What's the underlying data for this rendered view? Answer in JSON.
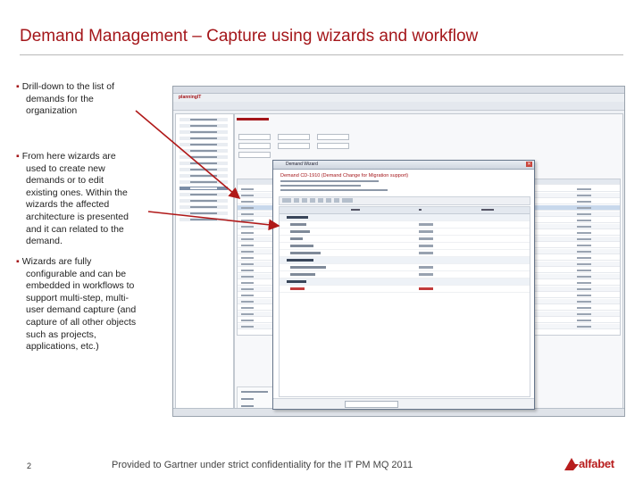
{
  "slide": {
    "title": "Demand Management – Capture using wizards and workflow",
    "page_number": "2",
    "footer": "Provided to Gartner under strict confidentiality for the IT PM MQ 2011",
    "brand": "alfabet",
    "accent_color": "#a4161a"
  },
  "bullets": [
    {
      "first": "Drill-down to the list of",
      "rest": [
        "demands for the",
        "organization"
      ]
    },
    {
      "first": "From here wizards are",
      "rest": [
        "used to create new",
        "demands or to edit",
        "existing ones. Within the",
        "wizards the affected",
        "architecture is presented",
        "and it can related to the",
        "demand."
      ]
    },
    {
      "first": "Wizards are fully",
      "rest": [
        "configurable and can be",
        "embedded in workflows to",
        "support multi-step, multi-",
        "user demand capture (and",
        "capture of all other objects",
        "such as projects,",
        "applications, etc.)"
      ]
    }
  ],
  "screenshot": {
    "app_brand": "planningIT",
    "dialog_title": "Demand Wizard",
    "dialog_heading": "Demand CD-1910 (Demand Change for Migration support)"
  }
}
